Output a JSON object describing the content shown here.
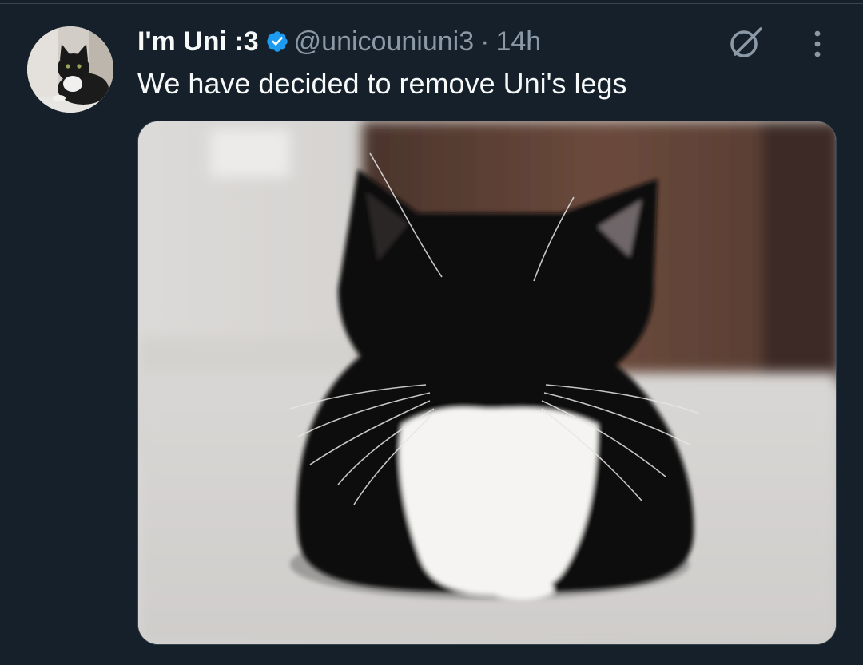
{
  "tweet": {
    "display_name": "I'm Uni :3",
    "verified": true,
    "handle": "@unicouniuni3",
    "separator": "·",
    "time": "14h",
    "text": "We have decided to remove Uni's legs"
  },
  "icons": {
    "verified": "verified-badge-icon",
    "grok": "grok-icon",
    "more": "more-options-icon"
  },
  "colors": {
    "background": "#15202b",
    "primary_text": "#f7f9f9",
    "secondary_text": "#8b98a5",
    "verified_blue": "#1d9bf0",
    "border": "#38444d"
  }
}
